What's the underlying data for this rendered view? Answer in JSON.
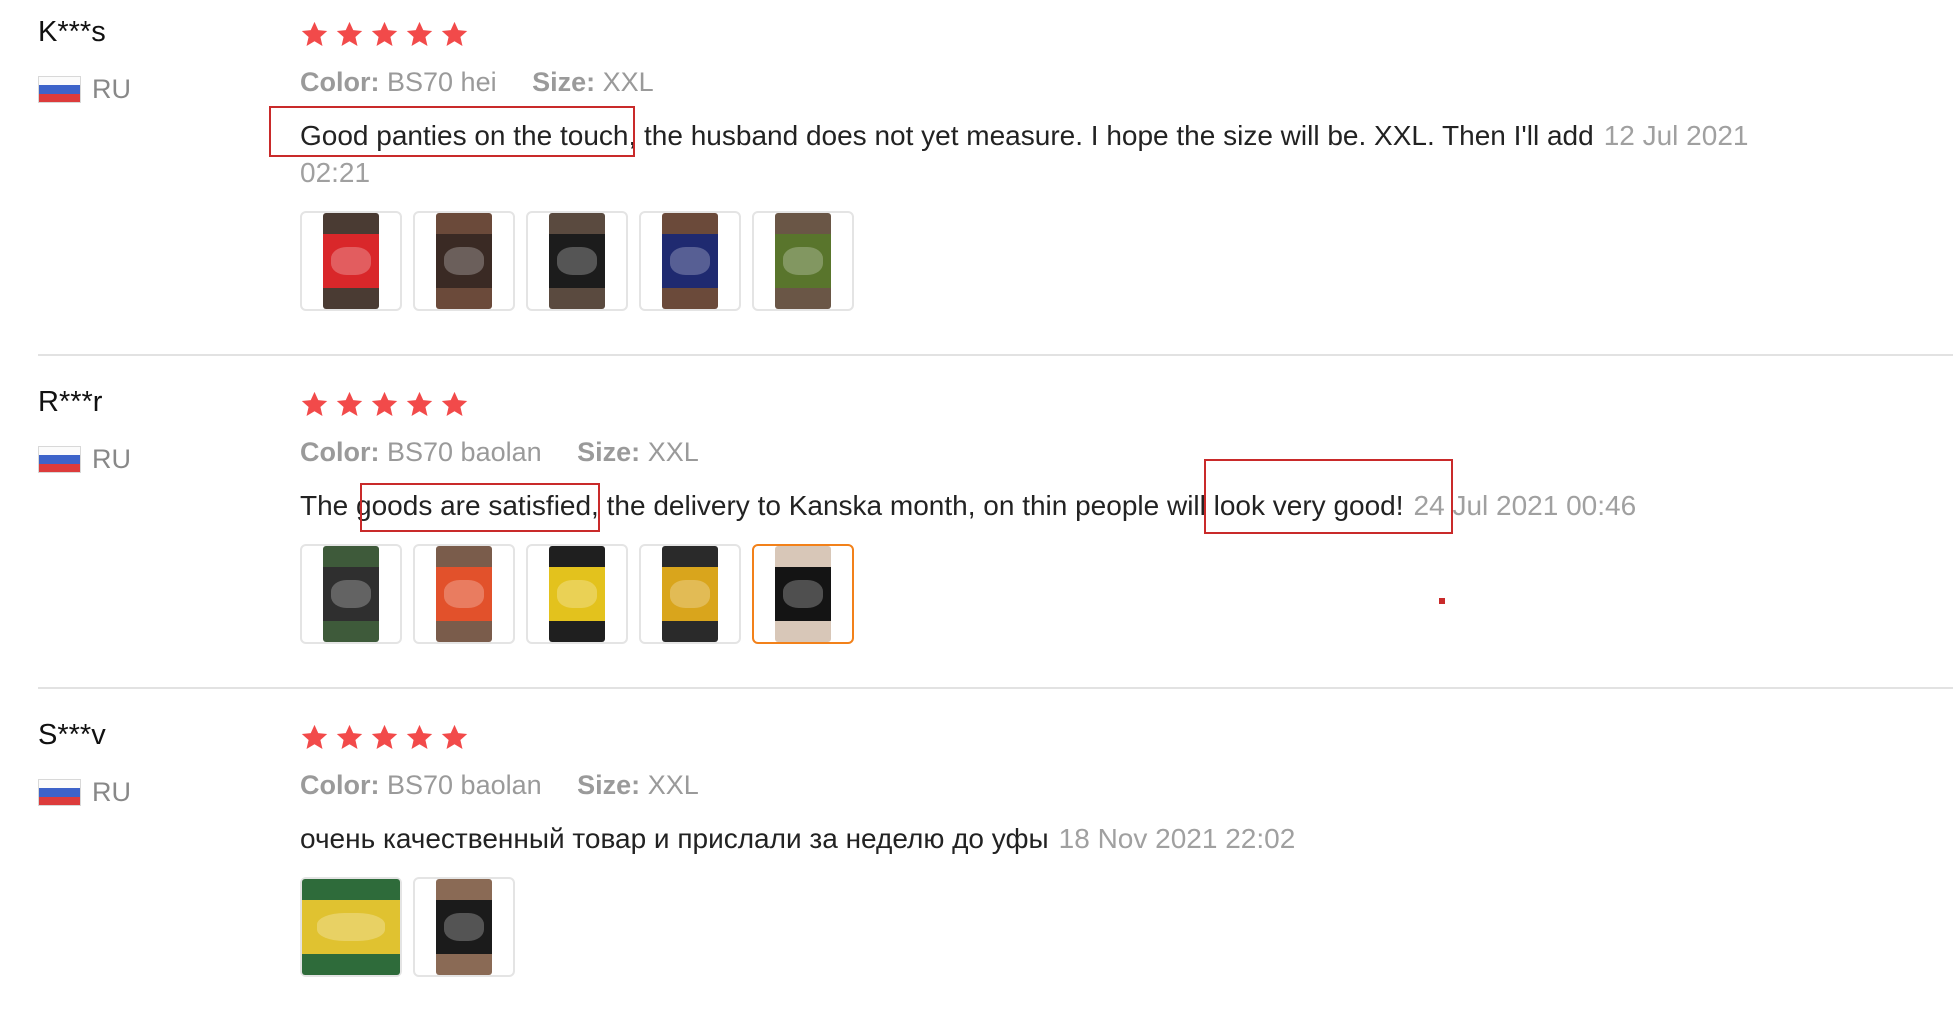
{
  "colors": {
    "star": "#f24a4a",
    "highlight": "#c92a2a",
    "active_thumb": "#f2811a",
    "muted": "#9a9a9a"
  },
  "reviews": [
    {
      "user": "K***s",
      "country": "RU",
      "rating": 5,
      "color_label": "Color:",
      "color_value": "BS70 hei",
      "size_label": "Size:",
      "size_value": "XXL",
      "text": "Good panties on the touch, the husband does not yet measure. I hope the size will be. XXL. Then I'll add",
      "date": "12 Jul 2021 02:21",
      "photos": [
        {
          "icon": "red-underwear-photo",
          "colors": [
            "#4a3b33",
            "#d9272a"
          ]
        },
        {
          "icon": "brown-underwear-photo",
          "colors": [
            "#6b4a3a",
            "#3a2a24"
          ]
        },
        {
          "icon": "black-underwear-photo",
          "colors": [
            "#5a4a3f",
            "#1c1c1c"
          ]
        },
        {
          "icon": "navy-underwear-photo",
          "colors": [
            "#6b4a3a",
            "#1f2a70"
          ]
        },
        {
          "icon": "green-underwear-photo",
          "colors": [
            "#6a5646",
            "#59752c"
          ]
        }
      ]
    },
    {
      "user": "R***r",
      "country": "RU",
      "rating": 5,
      "color_label": "Color:",
      "color_value": "BS70 baolan",
      "size_label": "Size:",
      "size_value": "XXL",
      "text": "The goods are satisfied, the delivery to Kanska month, on thin people will look very good!",
      "date": "24 Jul 2021 00:46",
      "photos": [
        {
          "icon": "package-photo",
          "colors": [
            "#3e5a3a",
            "#2f2f2f"
          ]
        },
        {
          "icon": "orange-underwear-photo",
          "colors": [
            "#7a5c4b",
            "#e2512b"
          ]
        },
        {
          "icon": "yellow-red-underwear-photo",
          "colors": [
            "#1f1f1f",
            "#e3c21d"
          ]
        },
        {
          "icon": "yellow-black-underwear-photo",
          "colors": [
            "#2a2a2a",
            "#d9a51c"
          ]
        },
        {
          "icon": "worn-underwear-photo",
          "colors": [
            "#d8c7b8",
            "#141414"
          ]
        }
      ]
    },
    {
      "user": "S***v",
      "country": "RU",
      "rating": 5,
      "color_label": "Color:",
      "color_value": "BS70 baolan",
      "size_label": "Size:",
      "size_value": "XXL",
      "text": "очень качественный товар и прислали за неделю до уфы",
      "date": "18 Nov 2021 22:02",
      "photos": [
        {
          "icon": "package-photo",
          "colors": [
            "#2e6b3a",
            "#e0c230"
          ]
        },
        {
          "icon": "yellow-black-underwear-photo",
          "colors": [
            "#8a6a55",
            "#1b1b1b"
          ]
        }
      ]
    }
  ]
}
